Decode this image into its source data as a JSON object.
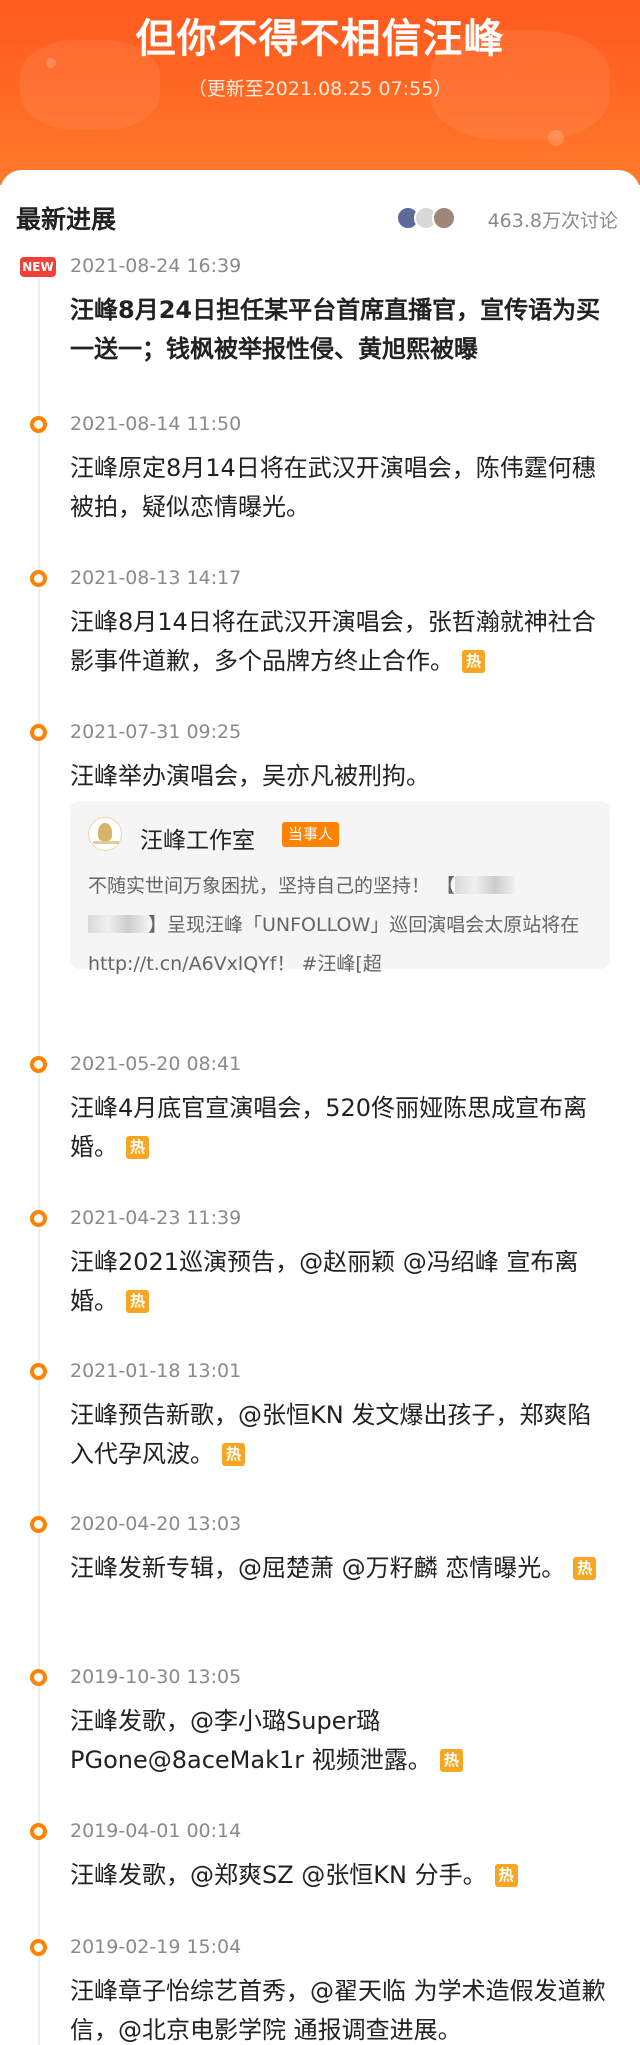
{
  "header": {
    "title": "但你不得不相信汪峰",
    "updated": "（更新至2021.08.25 07:55）"
  },
  "section": {
    "title": "最新进展",
    "discuss_count": "463.8万次讨论"
  },
  "colors": {
    "header_orange": "#ff6a24",
    "timeline_dot": "#ff8200",
    "hot_badge": "#f7a623",
    "new_badge": "#f04138"
  },
  "icons": {
    "new": "new-badge",
    "hot": "hot-badge",
    "dot": "timeline-dot"
  },
  "items": [
    {
      "time": "2021-08-24 16:39",
      "text": "汪峰8月24日担任某平台首席直播官，宣传语为买一送一；钱枫被举报性侵、黄旭熙被曝",
      "badge": "NEW",
      "hot": ""
    },
    {
      "time": "2021-08-14 11:50",
      "text": "汪峰原定8月14日将在武汉开演唱会，陈伟霆何穗被拍，疑似恋情曝光。",
      "hot": ""
    },
    {
      "time": "2021-08-13 14:17",
      "text": "汪峰8月14日将在武汉开演唱会，张哲瀚就神社合影事件道歉，多个品牌方终止合作。",
      "hot": "热"
    },
    {
      "time": "2021-07-31 09:25",
      "text": "汪峰举办演唱会，吴亦凡被刑拘。",
      "hot": ""
    },
    {
      "time": "2021-05-20 08:41",
      "text": "汪峰4月底官宣演唱会，520佟丽娅陈思成宣布离婚。",
      "hot": "热"
    },
    {
      "time": "2021-04-23 11:39",
      "text": "汪峰2021巡演预告，@赵丽颖 @冯绍峰 宣布离婚。",
      "hot": "热"
    },
    {
      "time": "2021-01-18 13:01",
      "text": "汪峰预告新歌，@张恒KN 发文爆出孩子，郑爽陷入代孕风波。",
      "hot": "热"
    },
    {
      "time": "2020-04-20 13:03",
      "text": "汪峰发新专辑，@屈楚萧 @万籽麟 恋情曝光。",
      "hot": "热"
    },
    {
      "time": "2019-10-30 13:05",
      "text": "汪峰发歌，@李小璐Super璐 PGone@8aceMak1r 视频泄露。",
      "hot": "热"
    },
    {
      "time": "2019-04-01 00:14",
      "text": "汪峰发歌，@郑爽SZ @张恒KN 分手。",
      "hot": "热"
    },
    {
      "time": "2019-02-19 15:04",
      "text": "汪峰章子怡综艺首秀，@翟天临 为学术造假发道歉信，@北京电影学院 通报调查进展。",
      "hot": ""
    }
  ],
  "quote": {
    "name": "汪峰工作室",
    "tag": "当事人",
    "line1": "不随实世间万象困扰，坚持自己的坚持！ 【",
    "line2": "】呈现汪峰「UNFOLLOW」巡回演唱会太原站将在http://t.cn/A6VxlQYf！ #汪峰[超"
  }
}
